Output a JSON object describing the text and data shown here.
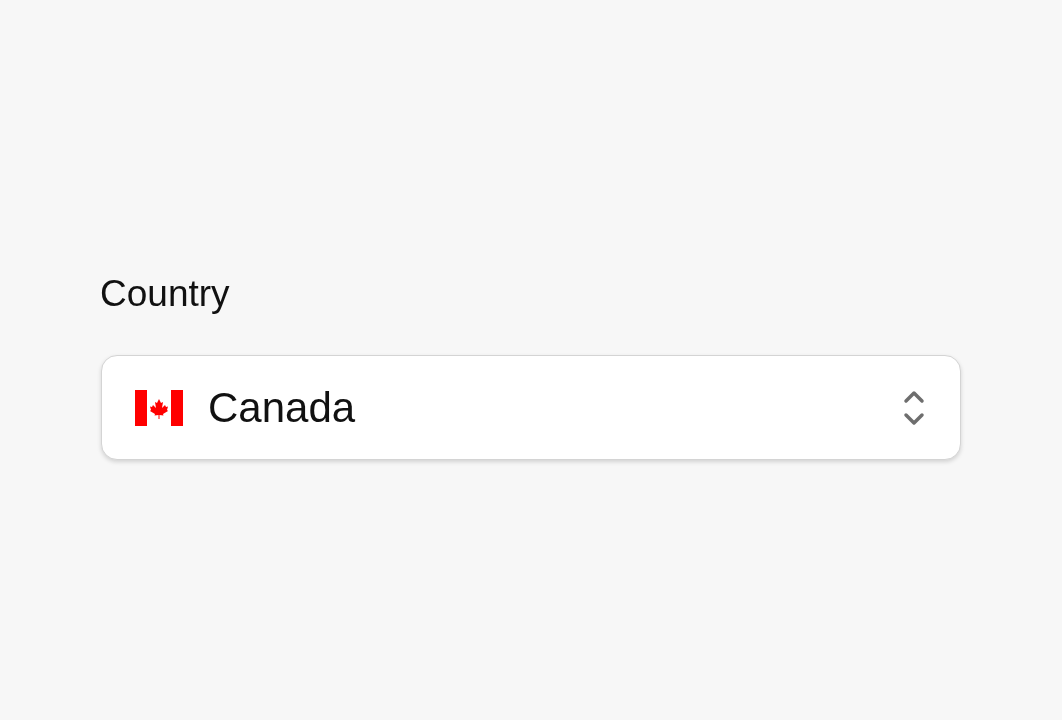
{
  "field": {
    "label": "Country",
    "value": "Canada"
  }
}
